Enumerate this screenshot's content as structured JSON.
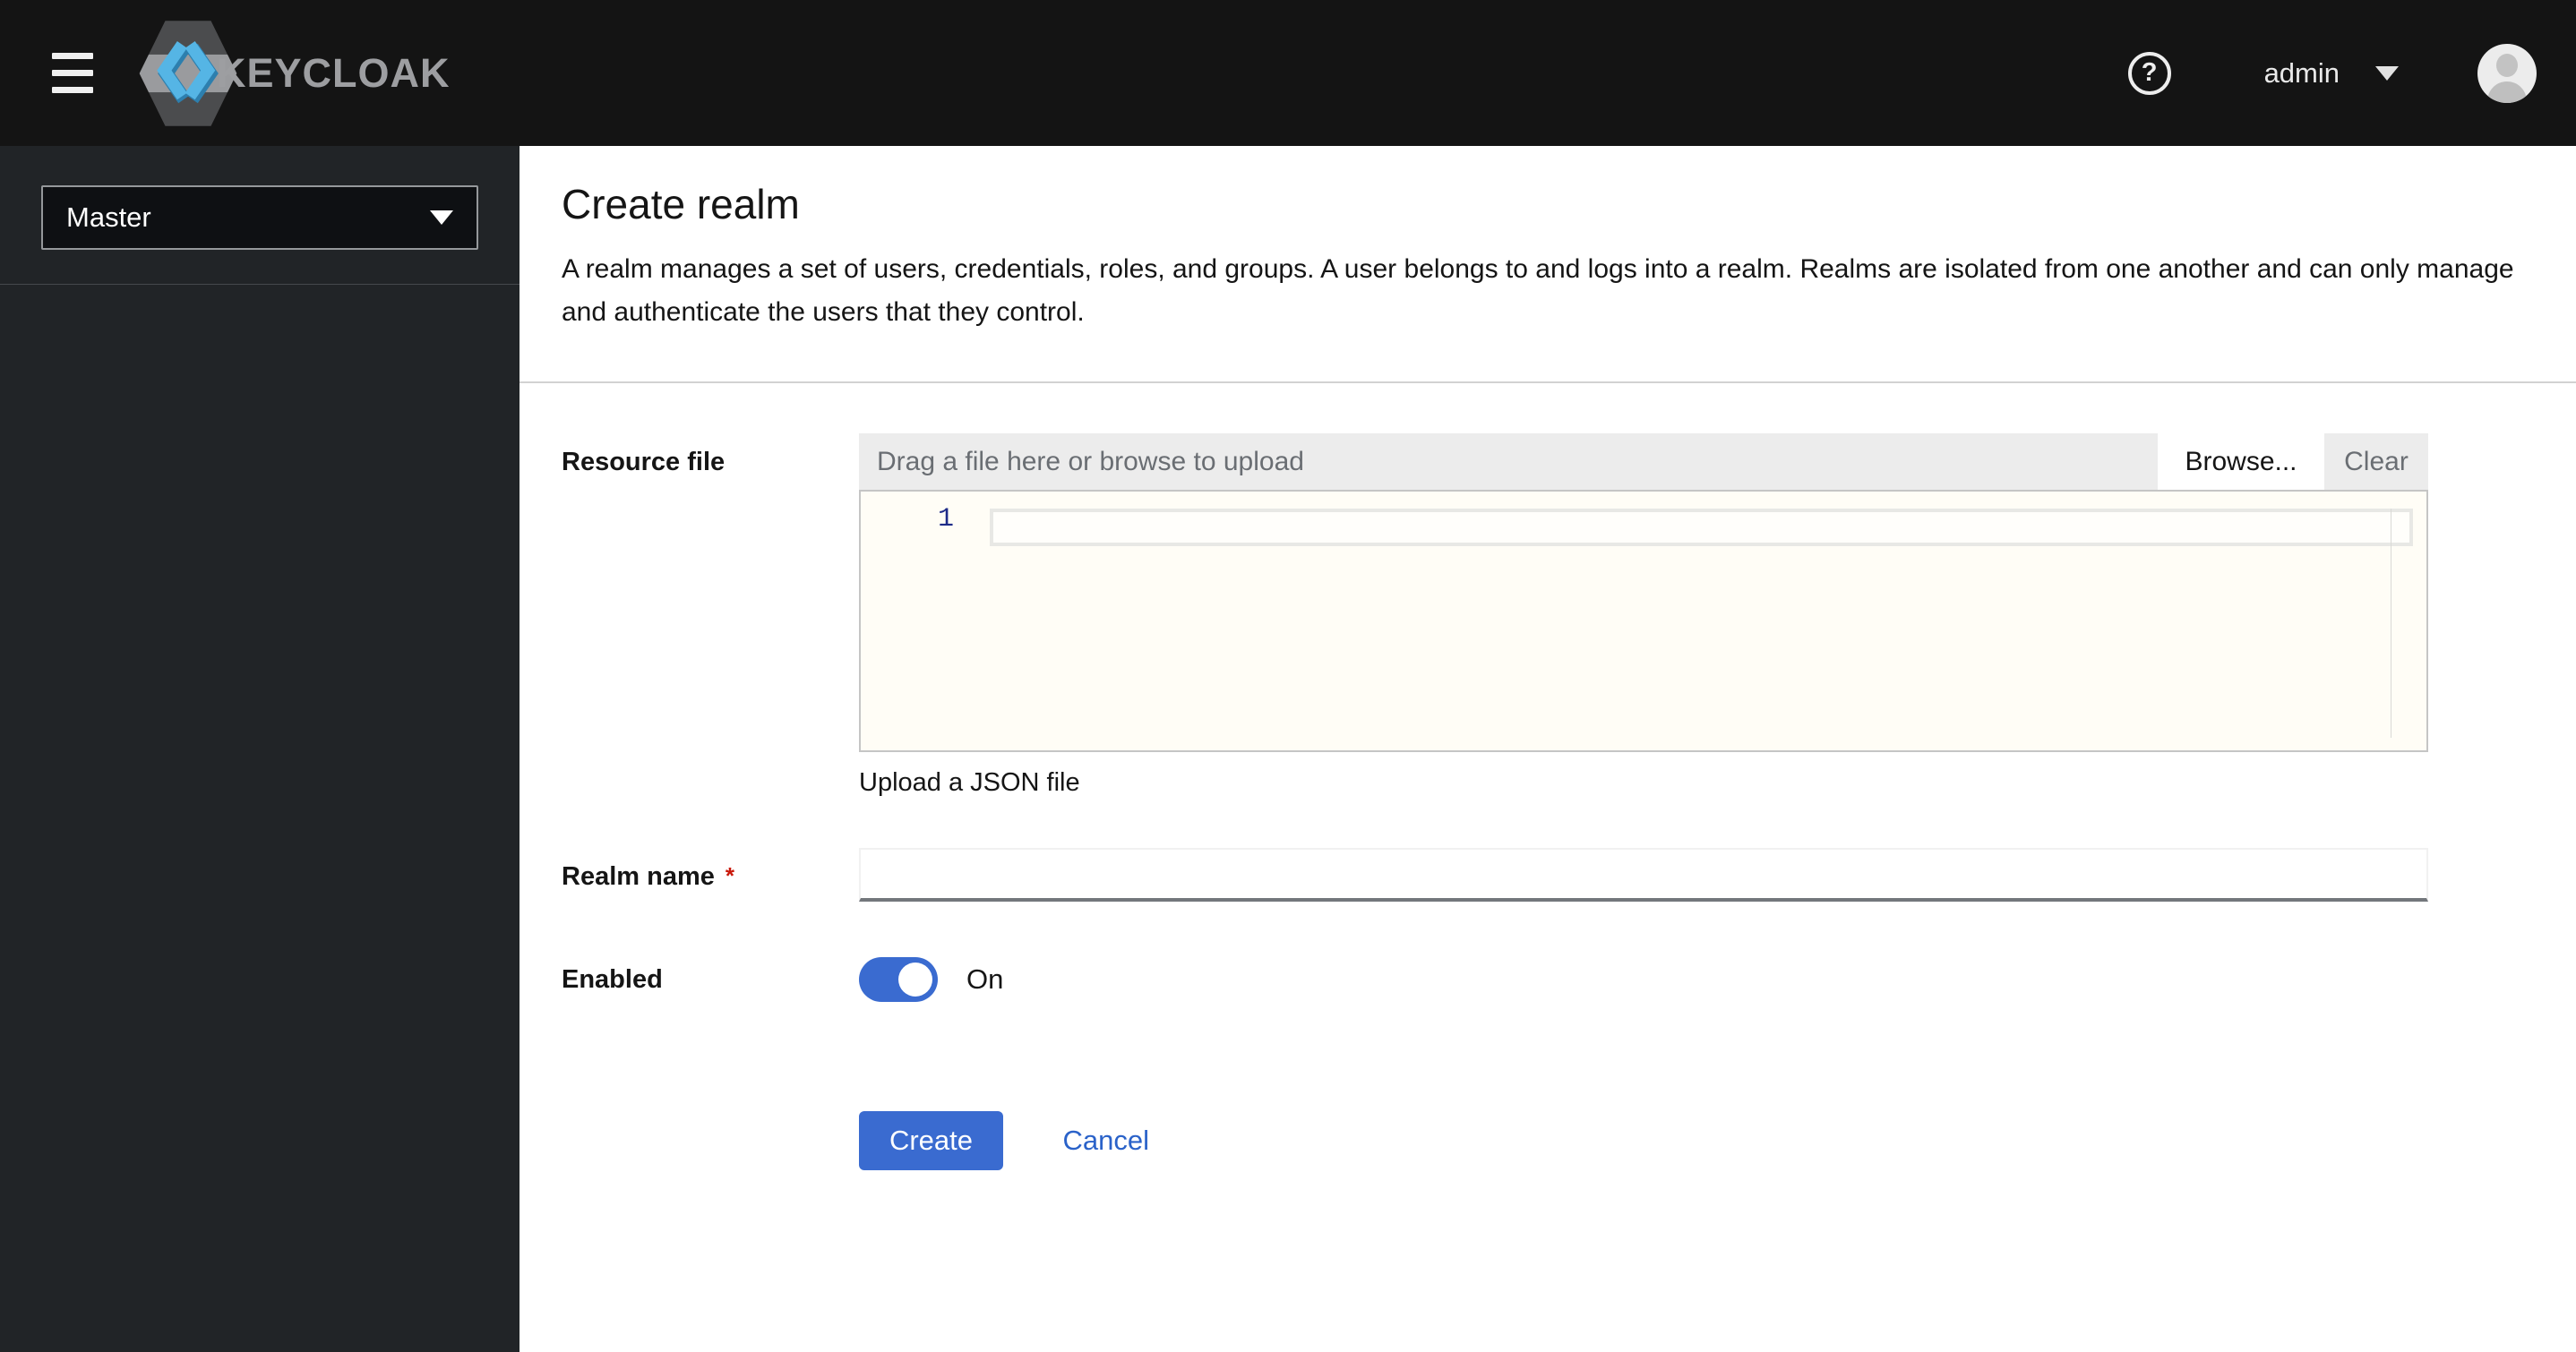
{
  "colors": {
    "accent_blue": "#3a6bd0",
    "link_blue": "#2a62c9",
    "danger_red": "#c9190b",
    "header_bg": "#141414",
    "sidebar_bg": "#212427"
  },
  "header": {
    "brand": "KEYCLOAK",
    "help_glyph": "?",
    "username": "admin"
  },
  "sidebar": {
    "realm_selector": {
      "value": "Master"
    }
  },
  "page": {
    "title": "Create realm",
    "description": "A realm manages a set of users, credentials, roles, and groups. A user belongs to and logs into a realm. Realms are isolated from one another and can only manage and authenticate the users that they control."
  },
  "form": {
    "resource_file": {
      "label": "Resource file",
      "placeholder": "Drag a file here or browse to upload",
      "browse_label": "Browse...",
      "clear_label": "Clear",
      "editor": {
        "line_number": "1",
        "content": ""
      },
      "helper_text": "Upload a JSON file"
    },
    "realm_name": {
      "label": "Realm name",
      "required_indicator": "*",
      "value": ""
    },
    "enabled": {
      "label": "Enabled",
      "checked": true,
      "state_label": "On"
    },
    "actions": {
      "create_label": "Create",
      "cancel_label": "Cancel"
    }
  }
}
